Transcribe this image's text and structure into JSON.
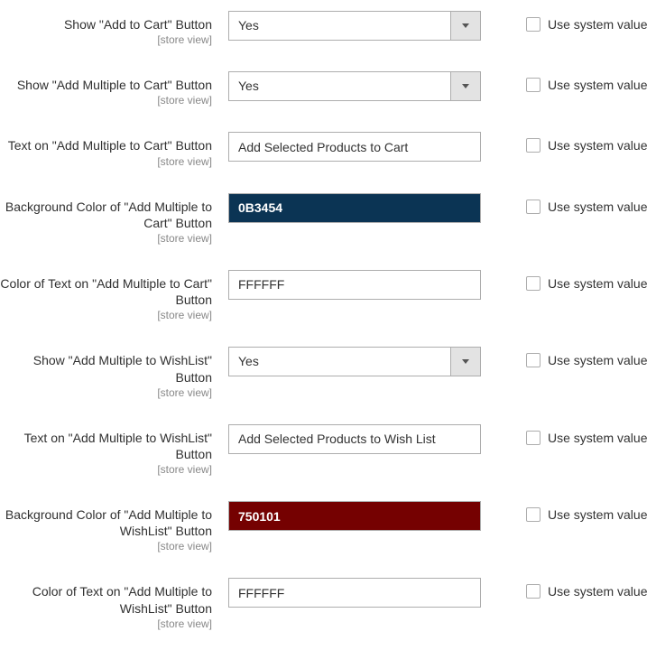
{
  "scope_label": "[store view]",
  "use_system_label": "Use system value",
  "rows": [
    {
      "label": "Show \"Add to Cart\" Button",
      "type": "select",
      "value": "Yes"
    },
    {
      "label": "Show \"Add Multiple to Cart\" Button",
      "type": "select",
      "value": "Yes"
    },
    {
      "label": "Text on \"Add Multiple to Cart\" Button",
      "type": "text",
      "value": "Add Selected Products to Cart"
    },
    {
      "label": "Background Color of \"Add Multiple to Cart\" Button",
      "type": "color",
      "value": "0B3454",
      "bg": "#0B3454",
      "fg": "#FFFFFF"
    },
    {
      "label": "Color of Text on \"Add Multiple to Cart\" Button",
      "type": "color",
      "value": "FFFFFF",
      "bg": "#FFFFFF",
      "fg": "#303030"
    },
    {
      "label": "Show \"Add Multiple to WishList\" Button",
      "type": "select",
      "value": "Yes"
    },
    {
      "label": "Text on \"Add Multiple to WishList\" Button",
      "type": "text",
      "value": "Add Selected Products to Wish List"
    },
    {
      "label": "Background Color of \"Add Multiple to WishList\" Button",
      "type": "color",
      "value": "750101",
      "bg": "#750101",
      "fg": "#FFFFFF"
    },
    {
      "label": "Color of Text on \"Add Multiple to WishList\" Button",
      "type": "color",
      "value": "FFFFFF",
      "bg": "#FFFFFF",
      "fg": "#303030"
    }
  ]
}
